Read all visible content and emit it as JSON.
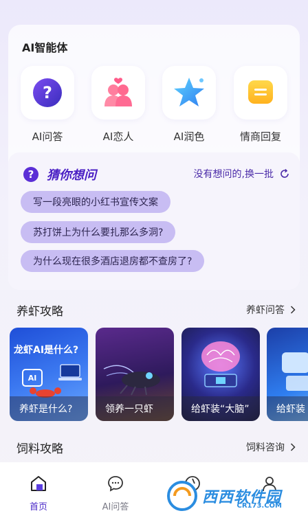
{
  "agents_section": {
    "title": "AI智能体",
    "items": [
      {
        "label": "AI问答",
        "icon": "question-bubble-icon"
      },
      {
        "label": "AI恋人",
        "icon": "couple-icon"
      },
      {
        "label": "AI润色",
        "icon": "star-icon"
      },
      {
        "label": "情商回复",
        "icon": "message-icon"
      }
    ]
  },
  "guess": {
    "badge": "?",
    "title": "猜你想问",
    "refresh_label": "没有想问的,换一批",
    "questions": [
      "写一段亮眼的小红书宣传文案",
      "苏打饼上为什么要扎那么多洞?",
      "为什么现在很多酒店退房都不查房了?"
    ]
  },
  "shrimp_guide": {
    "title": "养虾攻略",
    "more_label": "养虾问答",
    "cards": [
      {
        "caption": "养虾是什么?",
        "overlay_title": "龙虾AI是什么?",
        "overlay_badge": "AI"
      },
      {
        "caption": "领养一只虾"
      },
      {
        "caption": "给虾装“大脑”"
      },
      {
        "caption": "给虾装"
      }
    ]
  },
  "feed_guide": {
    "title": "饲料攻略",
    "more_label": "饲料咨询"
  },
  "tabbar": {
    "items": [
      {
        "label": "首页",
        "active": true
      },
      {
        "label": "AI问答",
        "active": false
      },
      {
        "label": "",
        "active": false
      },
      {
        "label": "",
        "active": false
      }
    ]
  },
  "watermark": {
    "text": "西西软件园",
    "sub": "CR173.COM"
  },
  "colors": {
    "accent": "#4b2ac8",
    "chip": "#c8bdf3",
    "brand_watermark": "#2b8de0"
  }
}
